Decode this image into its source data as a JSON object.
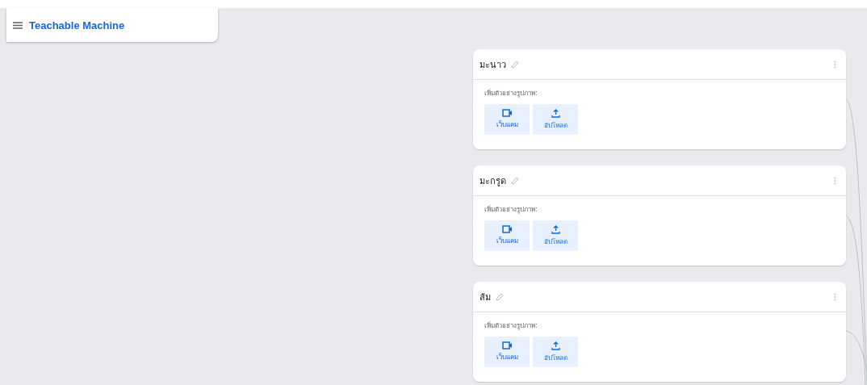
{
  "app": {
    "title": "Teachable Machine"
  },
  "classes": [
    {
      "name": "มะนาว",
      "prompt": "เพิ่มตัวอย่างรูปภาพ:",
      "buttons": [
        {
          "kind": "webcam",
          "label": "เว็บแคม"
        },
        {
          "kind": "upload",
          "label": "อัปโหลด"
        }
      ]
    },
    {
      "name": "มะกรูด",
      "prompt": "เพิ่มตัวอย่างรูปภาพ:",
      "buttons": [
        {
          "kind": "webcam",
          "label": "เว็บแคม"
        },
        {
          "kind": "upload",
          "label": "อัปโหลด"
        }
      ]
    },
    {
      "name": "ส้ม",
      "prompt": "เพิ่มตัวอย่างรูปภาพ:",
      "buttons": [
        {
          "kind": "webcam",
          "label": "เว็บแคม"
        },
        {
          "kind": "upload",
          "label": "อัปโหลด"
        }
      ]
    }
  ]
}
